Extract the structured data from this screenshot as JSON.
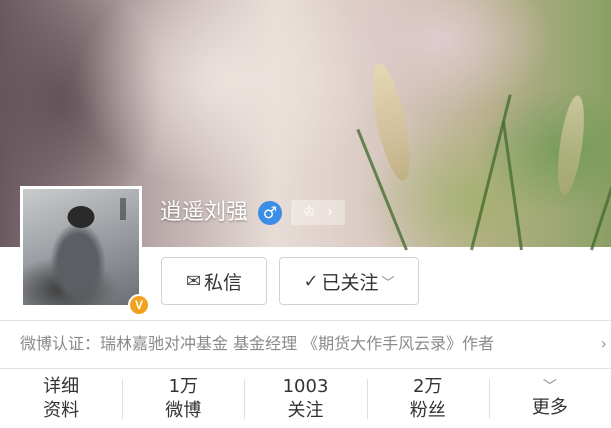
{
  "profile": {
    "name": "逍遥刘强",
    "gender_symbol": "♂",
    "member_badge": "♔",
    "member_arrow": "›",
    "verified_badge": "V"
  },
  "actions": {
    "message_icon": "✉",
    "message_label": "私信",
    "follow_icon": "✓",
    "follow_label": "已关注",
    "follow_caret": "﹀"
  },
  "verification": {
    "text": "微博认证：瑞林嘉驰对冲基金 基金经理 《期货大作手风云录》作者",
    "arrow": "›"
  },
  "stats": [
    {
      "top": "详细",
      "bottom": "资料"
    },
    {
      "top": "1万",
      "bottom": "微博"
    },
    {
      "top": "1003",
      "bottom": "关注"
    },
    {
      "top": "2万",
      "bottom": "粉丝"
    },
    {
      "top": "﹀",
      "bottom": "更多"
    }
  ],
  "colors": {
    "gender": "#3a8ee6",
    "verified": "#f0a21e"
  }
}
